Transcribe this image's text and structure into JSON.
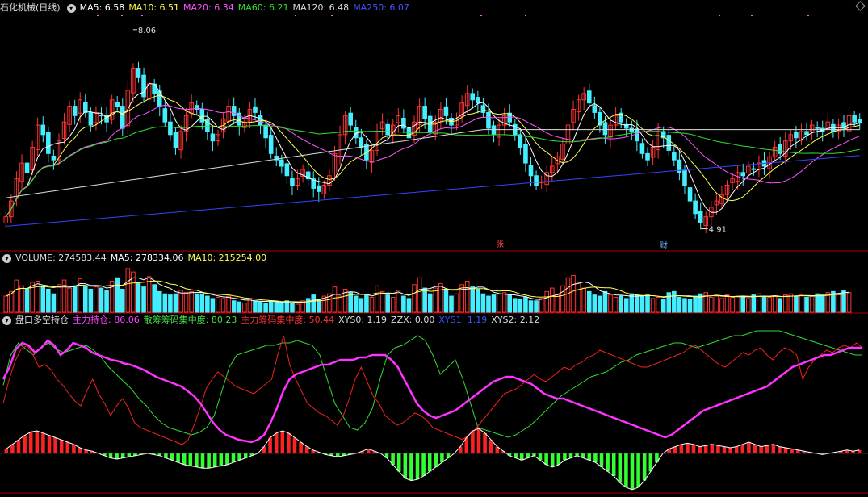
{
  "price_panel": {
    "title": "石化机械(日线)",
    "ma_labels": [
      {
        "text": "MA5: 6.58",
        "color": "#ffffff"
      },
      {
        "text": "MA10: 6.51",
        "color": "#ffff55"
      },
      {
        "text": "MA20: 6.34",
        "color": "#ff55ff"
      },
      {
        "text": "MA60: 6.21",
        "color": "#33dd33"
      },
      {
        "text": "MA120: 6.48",
        "color": "#dddddd"
      },
      {
        "text": "MA250: 6.07",
        "color": "#4455ff"
      }
    ],
    "high_label": "8.06",
    "low_label": "4.91",
    "marker_zhang": "张",
    "marker_cai": "财"
  },
  "volume_panel": {
    "labels": [
      {
        "text": "VOLUME: 274583.44",
        "color": "#dddddd"
      },
      {
        "text": "MA5: 278334.06",
        "color": "#ffffff"
      },
      {
        "text": "MA10: 215254.00",
        "color": "#ffff55"
      }
    ]
  },
  "indicator_panel": {
    "title": "盘口多空持仓",
    "labels": [
      {
        "text": "主力持仓: 86.06",
        "color": "#ff44ff"
      },
      {
        "text": "散筹筹码集中度: 80.23",
        "color": "#44dd44"
      },
      {
        "text": "主力筹码集中度: 50.44",
        "color": "#ff3333"
      },
      {
        "text": "XYS0: 1.19",
        "color": "#dddddd"
      },
      {
        "text": "ZZX: 0.00",
        "color": "#dddddd"
      },
      {
        "text": "XYS1: 1.19",
        "color": "#3355ff"
      },
      {
        "text": "XYS2: 2.12",
        "color": "#dddddd"
      }
    ]
  },
  "colors": {
    "up": "#ff3333",
    "down": "#44eeff",
    "grid": "#aa0000",
    "ma5": "#ffffff",
    "ma10": "#ffff55",
    "ma20": "#ff55ff",
    "ma60": "#33dd33",
    "ma120": "#dddddd",
    "ma250": "#3344ff",
    "hold": "#ff33ff",
    "retail": "#33dd33",
    "main": "#ee2222",
    "hist_up": "#ff2222",
    "hist_dn": "#33ff33",
    "xys": "#ffffff"
  },
  "chart_data": {
    "type": "candlestick",
    "ylim": [
      4.7,
      8.3
    ],
    "closes": [
      5.1,
      5.35,
      5.7,
      5.95,
      5.8,
      6.2,
      6.55,
      6.4,
      6.1,
      6.0,
      6.3,
      6.6,
      6.85,
      6.7,
      6.95,
      6.75,
      6.55,
      6.75,
      6.7,
      6.6,
      6.95,
      6.85,
      6.5,
      7.1,
      7.45,
      7.3,
      7.0,
      7.2,
      7.05,
      6.85,
      6.6,
      6.4,
      6.2,
      6.45,
      6.7,
      6.9,
      6.8,
      6.6,
      6.45,
      6.3,
      6.4,
      6.65,
      6.85,
      6.7,
      6.55,
      6.6,
      6.8,
      6.75,
      6.55,
      6.35,
      6.1,
      6.0,
      5.9,
      5.75,
      5.6,
      5.7,
      5.85,
      5.7,
      5.55,
      5.5,
      5.6,
      5.75,
      6.1,
      6.4,
      6.7,
      6.55,
      6.35,
      6.2,
      6.0,
      6.15,
      6.45,
      6.6,
      6.4,
      6.55,
      6.7,
      6.5,
      6.35,
      6.6,
      6.85,
      6.65,
      6.45,
      6.6,
      6.8,
      6.7,
      6.55,
      6.65,
      6.9,
      7.05,
      6.95,
      6.9,
      6.75,
      6.5,
      6.4,
      6.55,
      6.7,
      6.6,
      6.4,
      6.2,
      5.95,
      5.75,
      5.6,
      5.65,
      5.8,
      5.9,
      6.05,
      6.25,
      6.55,
      6.8,
      6.95,
      7.05,
      6.9,
      6.75,
      6.55,
      6.4,
      6.55,
      6.7,
      6.6,
      6.5,
      6.45,
      6.3,
      6.1,
      6.0,
      6.2,
      6.45,
      6.35,
      6.15,
      6.0,
      5.8,
      5.6,
      5.35,
      5.15,
      5.0,
      5.1,
      5.25,
      5.35,
      5.45,
      5.6,
      5.7,
      5.8,
      5.75,
      5.9,
      5.85,
      5.95,
      5.9,
      6.05,
      6.2,
      6.1,
      6.3,
      6.4,
      6.35,
      6.45,
      6.4,
      6.55,
      6.5,
      6.45,
      6.6,
      6.45,
      6.55,
      6.5,
      6.7,
      6.6,
      6.58
    ],
    "volumes": [
      1.4,
      1.8,
      2.8,
      2.3,
      2.0,
      2.6,
      2.7,
      2.2,
      2.0,
      1.6,
      2.4,
      2.8,
      2.1,
      2.3,
      2.9,
      2.3,
      2.0,
      2.2,
      2.1,
      1.9,
      2.7,
      3.0,
      2.0,
      3.8,
      3.5,
      2.6,
      2.2,
      3.1,
      2.4,
      1.8,
      1.6,
      1.5,
      1.6,
      1.9,
      1.7,
      1.8,
      1.6,
      1.6,
      1.4,
      1.2,
      1.3,
      1.2,
      1.4,
      1.0,
      0.9,
      0.8,
      1.2,
      1.0,
      0.9,
      0.8,
      1.0,
      0.9,
      0.8,
      1.0,
      0.8,
      0.7,
      1.0,
      1.2,
      1.5,
      1.1,
      1.4,
      1.6,
      2.2,
      1.4,
      2.0,
      1.7,
      1.4,
      1.2,
      1.5,
      1.3,
      2.3,
      1.8,
      1.5,
      1.3,
      1.9,
      1.4,
      1.2,
      2.4,
      3.0,
      2.1,
      1.6,
      2.1,
      2.5,
      2.0,
      1.4,
      1.6,
      2.4,
      2.7,
      2.2,
      2.0,
      1.6,
      1.4,
      1.5,
      1.6,
      1.7,
      1.5,
      1.2,
      1.1,
      1.3,
      1.0,
      1.0,
      1.2,
      1.8,
      2.1,
      1.5,
      2.3,
      3.0,
      3.2,
      2.6,
      2.1,
      1.8,
      1.5,
      1.4,
      1.8,
      1.5,
      1.3,
      1.4,
      1.2,
      1.6,
      1.5,
      1.4,
      1.5,
      1.2,
      1.3,
      1.1,
      1.7,
      1.8,
      1.3,
      1.2,
      1.1,
      1.4,
      1.6,
      1.7,
      1.3,
      1.4,
      1.2,
      1.5,
      1.3,
      1.4,
      1.3,
      1.2,
      1.5,
      1.6,
      1.4,
      1.3,
      1.4,
      1.2,
      1.5,
      1.6,
      1.4,
      1.5,
      1.3,
      1.4,
      1.6,
      1.5,
      1.7,
      1.8,
      1.6,
      1.9,
      1.7
    ],
    "hold": [
      60,
      70,
      85,
      90,
      88,
      82,
      86,
      92,
      88,
      80,
      84,
      90,
      88,
      86,
      82,
      80,
      78,
      76,
      75,
      73,
      72,
      70,
      68,
      65,
      62,
      60,
      58,
      56,
      54,
      50,
      46,
      40,
      32,
      24,
      18,
      14,
      12,
      10,
      9,
      8,
      10,
      14,
      24,
      36,
      50,
      60,
      64,
      66,
      68,
      70,
      72,
      72,
      74,
      76,
      76,
      76,
      78,
      78,
      80,
      80,
      80,
      76,
      70,
      60,
      50,
      40,
      34,
      30,
      28,
      30,
      32,
      34,
      38,
      42,
      46,
      50,
      54,
      58,
      60,
      62,
      62,
      60,
      58,
      56,
      52,
      48,
      46,
      44,
      44,
      42,
      40,
      38,
      36,
      34,
      32,
      30,
      28,
      26,
      24,
      22,
      20,
      18,
      16,
      14,
      12,
      14,
      18,
      22,
      26,
      30,
      34,
      36,
      38,
      40,
      42,
      44,
      46,
      48,
      50,
      52,
      54,
      58,
      62,
      66,
      70,
      72,
      74,
      76,
      78,
      80,
      80,
      82,
      84,
      86,
      86,
      86
    ],
    "retail": [
      55,
      80,
      90,
      85,
      80,
      86,
      90,
      85,
      82,
      84,
      86,
      88,
      84,
      78,
      70,
      64,
      58,
      52,
      44,
      38,
      30,
      24,
      20,
      18,
      16,
      14,
      16,
      20,
      30,
      50,
      70,
      80,
      82,
      84,
      86,
      88,
      88,
      90,
      90,
      92,
      90,
      88,
      80,
      60,
      40,
      30,
      20,
      18,
      24,
      36,
      60,
      80,
      86,
      88,
      92,
      96,
      92,
      80,
      64,
      70,
      76,
      60,
      40,
      20,
      18,
      16,
      14,
      12,
      14,
      18,
      22,
      28,
      34,
      40,
      46,
      50,
      54,
      58,
      62,
      64,
      66,
      70,
      74,
      76,
      80,
      82,
      84,
      86,
      88,
      90,
      90,
      88,
      86,
      88,
      90,
      92,
      94,
      96,
      96,
      98,
      100,
      100,
      100,
      100,
      98,
      96,
      94,
      92,
      90,
      88,
      86,
      84,
      82,
      80,
      80
    ],
    "main": [
      40,
      60,
      75,
      85,
      88,
      80,
      70,
      72,
      68,
      60,
      55,
      48,
      42,
      38,
      50,
      60,
      48,
      40,
      30,
      38,
      44,
      36,
      24,
      20,
      18,
      16,
      14,
      12,
      10,
      8,
      6,
      10,
      22,
      36,
      52,
      60,
      66,
      62,
      58,
      54,
      52,
      50,
      48,
      52,
      56,
      60,
      80,
      96,
      72,
      60,
      50,
      40,
      36,
      32,
      30,
      26,
      22,
      30,
      44,
      60,
      70,
      58,
      46,
      40,
      30,
      26,
      22,
      24,
      28,
      32,
      30,
      26,
      20,
      18,
      16,
      14,
      12,
      10,
      14,
      18,
      24,
      30,
      36,
      42,
      48,
      50,
      52,
      56,
      60,
      64,
      60,
      58,
      62,
      66,
      70,
      68,
      72,
      74,
      78,
      80,
      84,
      82,
      80,
      78,
      76,
      74,
      72,
      70,
      70,
      72,
      74,
      76,
      78,
      80,
      82,
      86,
      88,
      84,
      80,
      76,
      72,
      70,
      74,
      78,
      82,
      80,
      84,
      86,
      80,
      76,
      82,
      86,
      84,
      80,
      60,
      70,
      76,
      80,
      84,
      82,
      86,
      88,
      86,
      90,
      86
    ],
    "hist": [
      0.4,
      0.8,
      1.2,
      1.6,
      1.9,
      2.0,
      1.8,
      1.6,
      1.4,
      1.2,
      1.0,
      0.8,
      0.5,
      0.3,
      0.2,
      0.0,
      -0.2,
      -0.4,
      -0.5,
      -0.4,
      -0.3,
      -0.2,
      -0.1,
      0.0,
      -0.1,
      -0.2,
      -0.4,
      -0.6,
      -0.8,
      -1.0,
      -1.1,
      -1.2,
      -1.3,
      -1.3,
      -1.2,
      -1.1,
      -1.0,
      -0.8,
      -0.6,
      -0.4,
      -0.2,
      0.0,
      0.6,
      1.4,
      1.8,
      2.0,
      1.8,
      1.4,
      1.0,
      0.6,
      0.3,
      0.1,
      -0.1,
      -0.2,
      -0.3,
      -0.2,
      -0.1,
      0.0,
      0.2,
      0.4,
      0.2,
      0.0,
      -0.4,
      -1.0,
      -1.6,
      -2.2,
      -2.4,
      -2.3,
      -2.0,
      -1.6,
      -1.2,
      -0.8,
      -0.4,
      0.0,
      0.6,
      1.4,
      2.0,
      2.2,
      1.8,
      1.2,
      0.6,
      0.2,
      -0.2,
      -0.4,
      -0.6,
      -0.4,
      -0.2,
      -0.6,
      -1.0,
      -1.2,
      -1.0,
      -0.6,
      -0.4,
      -0.2,
      -0.4,
      -0.6,
      -0.8,
      -1.2,
      -1.6,
      -2.0,
      -2.6,
      -3.0,
      -3.2,
      -3.0,
      -2.4,
      -1.6,
      -0.8,
      0.0,
      0.4,
      0.6,
      0.8,
      0.9,
      0.8,
      0.6,
      0.7,
      0.8,
      0.7,
      0.6,
      0.5,
      0.6,
      0.8,
      1.0,
      0.8,
      0.6,
      0.7,
      0.8,
      0.6,
      0.5,
      0.4,
      0.3,
      0.2,
      0.1,
      0.0,
      -0.1,
      0.0,
      0.1,
      0.2,
      0.3,
      0.2,
      0.3
    ]
  }
}
